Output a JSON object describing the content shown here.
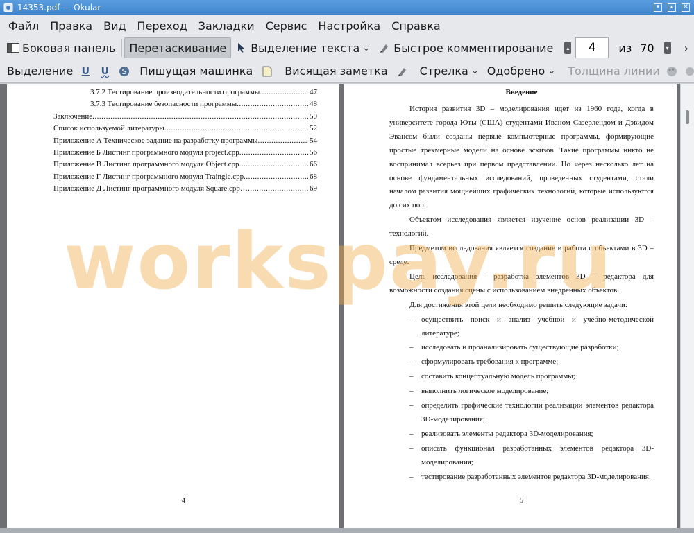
{
  "window": {
    "title": "14353.pdf — Okular",
    "buttons": [
      "▾",
      "▴",
      "✕"
    ]
  },
  "menu": [
    "Файл",
    "Правка",
    "Вид",
    "Переход",
    "Закладки",
    "Сервис",
    "Настройка",
    "Справка"
  ],
  "toolbar1": {
    "sidebar_label": "Боковая панель",
    "drag_label": "Перетаскивание",
    "text_select_label": "Выделение текста",
    "quick_comment_label": "Быстрое комментирование",
    "page_current": "4",
    "page_of": "из",
    "page_total": "70"
  },
  "toolbar2": {
    "selection_label": "Выделение",
    "typewriter_label": "Пишущая машинка",
    "hanging_note_label": "Висящая заметка",
    "arrow_label": "Стрелка",
    "stamp_label": "Одобрено",
    "line_width_label": "Толщина линии"
  },
  "left_page": {
    "toc": [
      {
        "title": "3.7.2 Тестирование производительности программы",
        "page": "47",
        "sub": true
      },
      {
        "title": "3.7.3 Тестирование безопасности программы",
        "page": "48",
        "sub": true
      },
      {
        "title": "Заключение",
        "page": "50",
        "sub": false
      },
      {
        "title": "Список используемой литературы",
        "page": "52",
        "sub": false
      },
      {
        "title": "Приложение А Техническое задание на разработку программы",
        "page": "54",
        "sub": false
      },
      {
        "title": "Приложение Б Листинг программного модуля project.cpp",
        "page": "56",
        "sub": false
      },
      {
        "title": "Приложение В Листинг программного модуля Object.cpp",
        "page": "66",
        "sub": false
      },
      {
        "title": "Приложение Г Листинг программного модуля Traingle.cpp",
        "page": "68",
        "sub": false
      },
      {
        "title": "Приложение Д Листинг программного модуля Square.cpp…",
        "page": "69",
        "sub": false
      }
    ],
    "page_number": "4"
  },
  "right_page": {
    "heading": "Введение",
    "paragraphs": [
      "История развития 3D – моделирования идет из 1960 года, когда в университете города Юты (США) студентами Иваном Сазерлендом и Дэвидом Эвансом были созданы первые компьютерные программы, формирующие простые трехмерные модели на основе эскизов. Такие программы никто не воспринимал всерьез при первом представлении. Но через несколько лет на основе фундаментальных исследований, проведенных студентами, стали началом развития мощнейших графических технологий, которые используются до сих пор.",
      "Объектом исследования является изучение основ реализации 3D – технологий.",
      "Предметом исследования является создание и работа с объектами в 3D – среде.",
      "Цель исследования - разработка элементов 3D – редактора для возможности создания сцены с использованием внедренных объектов.",
      "Для достижения этой цели необходимо решить следующие задачи:"
    ],
    "tasks": [
      "осуществить поиск и анализ учебной и учебно-методической литературе;",
      "исследовать и проанализировать существующие разработки;",
      "сформулировать требования к программе;",
      "составить концептуальную модель программы;",
      "выполнить логическое моделирование;",
      "определить графические технологии реализации элементов редактора 3D-моделирования;",
      "реализовать элементы редактора 3D-моделирования;",
      "описать функционал разработанных элементов редактора 3D-моделирования;",
      "тестирование разработанных элементов редактора 3D-моделирования."
    ],
    "dash": "–",
    "page_number": "5"
  },
  "watermark": "workspay.ru"
}
